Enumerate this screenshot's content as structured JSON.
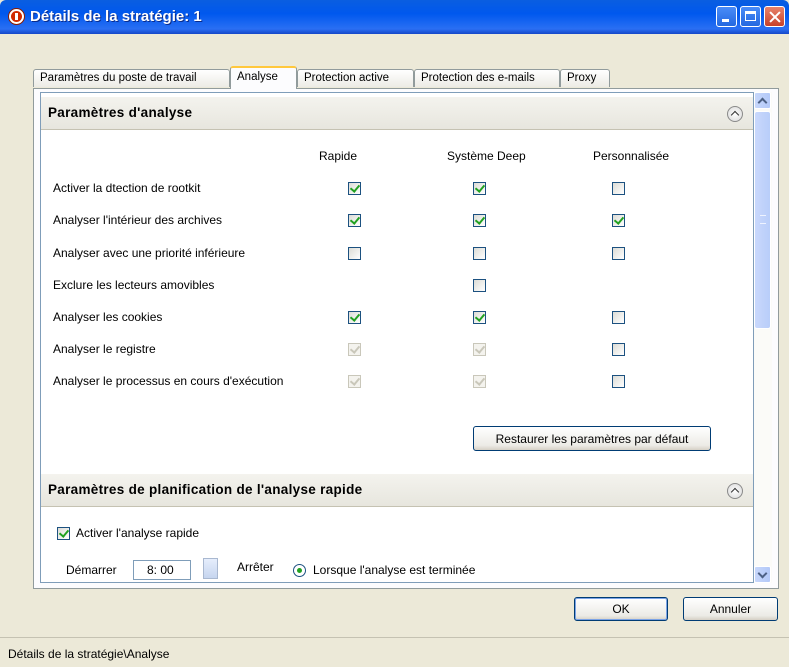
{
  "window": {
    "title": "Détails de la stratégie: 1"
  },
  "tabs": [
    {
      "label": "Paramètres du poste de travail",
      "active": false
    },
    {
      "label": "Analyse",
      "active": true
    },
    {
      "label": "Protection active",
      "active": false
    },
    {
      "label": "Protection des e-mails",
      "active": false
    },
    {
      "label": "Proxy",
      "active": false
    }
  ],
  "scan_settings": {
    "title": "Paramètres d'analyse",
    "columns": [
      "Rapide",
      "Système Deep",
      "Personnalisée"
    ],
    "rows": [
      {
        "label": "Activer la dtection de rootkit",
        "rapide": "checked",
        "deep": "checked",
        "custom": "unchecked"
      },
      {
        "label": "Analyser l'intérieur des archives",
        "rapide": "checked",
        "deep": "checked",
        "custom": "checked"
      },
      {
        "label": "Analyser avec une priorité inférieure",
        "rapide": "unchecked",
        "deep": "unchecked",
        "custom": "unchecked"
      },
      {
        "label": "Exclure les lecteurs amovibles",
        "rapide": "none",
        "deep": "unchecked",
        "custom": "none"
      },
      {
        "label": "Analyser les cookies",
        "rapide": "checked",
        "deep": "checked",
        "custom": "unchecked"
      },
      {
        "label": "Analyser le registre",
        "rapide": "checked-disabled",
        "deep": "checked-disabled",
        "custom": "unchecked"
      },
      {
        "label": "Analyser le processus en cours d'exécution",
        "rapide": "checked-disabled",
        "deep": "checked-disabled",
        "custom": "unchecked"
      }
    ],
    "restore_label": "Restaurer les paramètres par défaut"
  },
  "schedule": {
    "title": "Paramètres de planification de l'analyse rapide",
    "enable_label": "Activer l'analyse rapide",
    "enable_checked": true,
    "start_label": "Démarrer",
    "start_value": "8: 00",
    "stop_label": "Arrêter",
    "stop_option": "Lorsque l'analyse est terminée"
  },
  "buttons": {
    "ok": "OK",
    "cancel": "Annuler"
  },
  "status_bar": "Détails de la stratégie\\Analyse"
}
